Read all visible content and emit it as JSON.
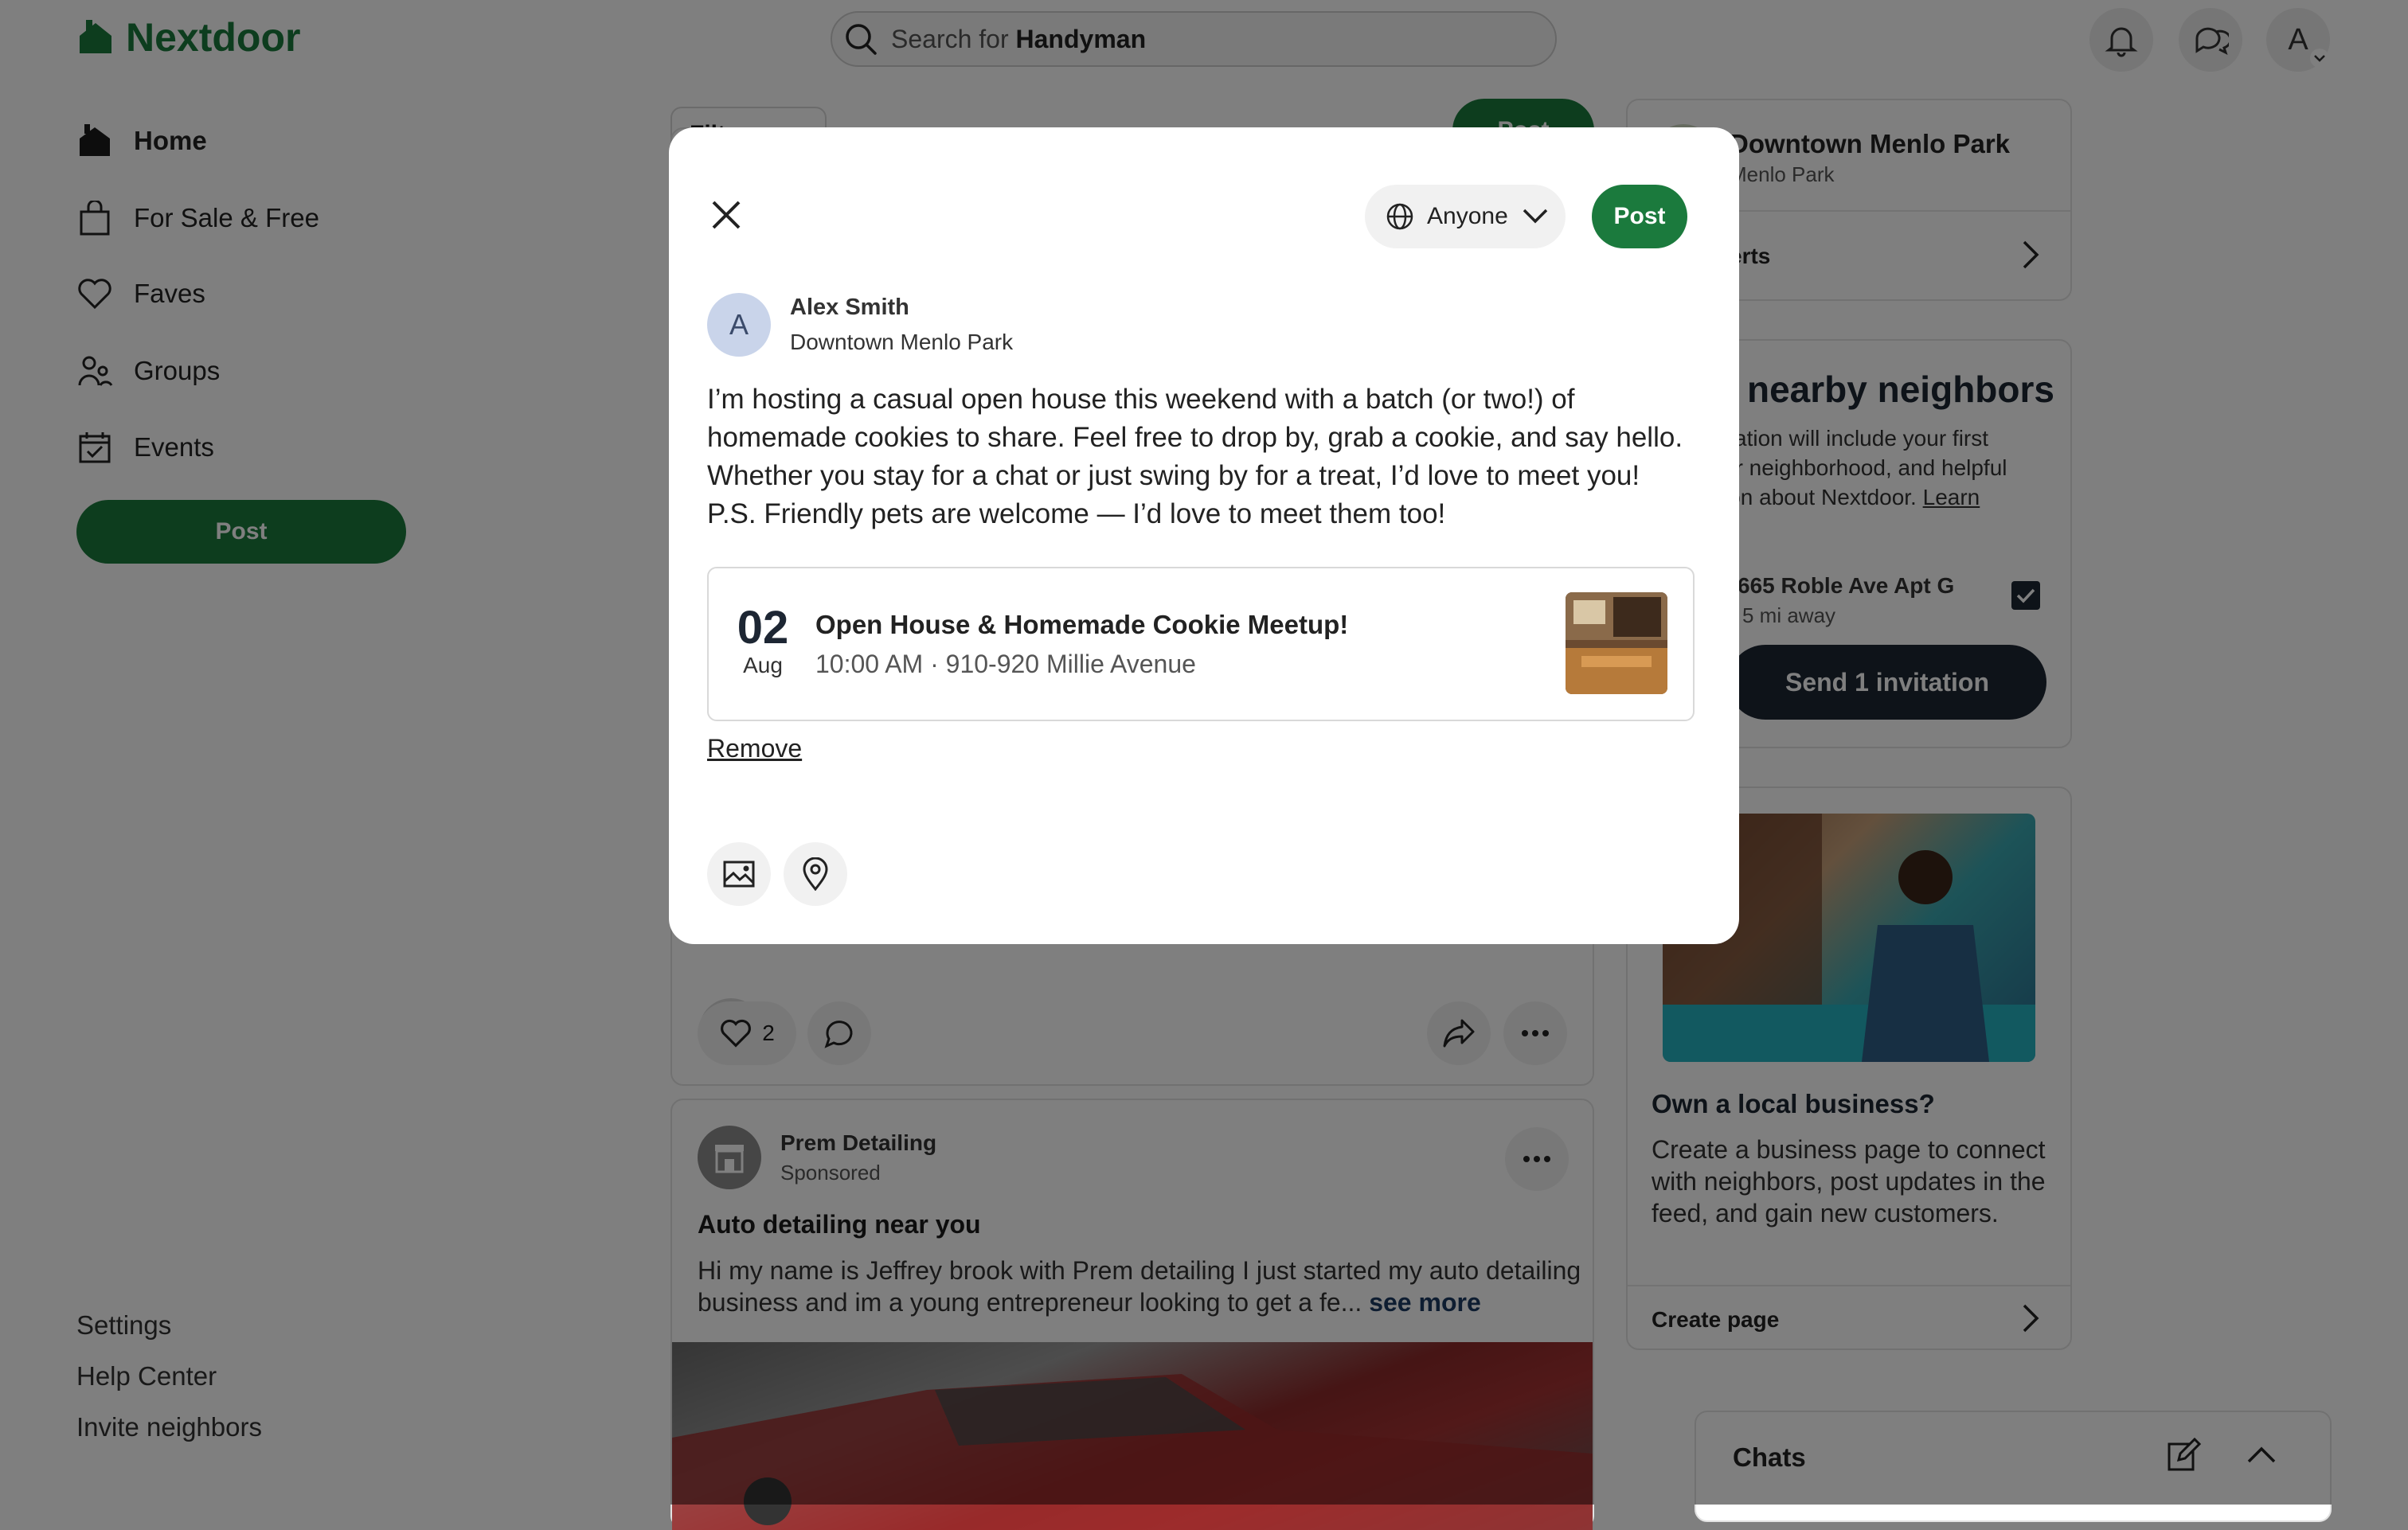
{
  "header": {
    "logo_text": "Nextdoor",
    "search_prefix": "Search for",
    "search_term": "Handyman",
    "avatar_initial": "A"
  },
  "sidebar": {
    "items": [
      {
        "label": "Home",
        "icon": "home-icon",
        "active": true
      },
      {
        "label": "For Sale & Free",
        "icon": "shopping-bag-icon"
      },
      {
        "label": "Faves",
        "icon": "heart-icon"
      },
      {
        "label": "Groups",
        "icon": "groups-icon"
      },
      {
        "label": "Events",
        "icon": "calendar-icon"
      }
    ],
    "post_label": "Post",
    "footer": [
      "Settings",
      "Help Center",
      "Invite neighbors"
    ]
  },
  "feed": {
    "filter_label": "Filt",
    "post_label": "Post",
    "post_actions": {
      "like_count": "2"
    },
    "sponsored": {
      "name": "Prem Detailing",
      "tag": "Sponsored",
      "title": "Auto detailing near you",
      "text": "Hi my name is Jeffrey brook with Prem detailing I just started my auto detailing business and im a young entrepreneur looking to get a fe...",
      "see_more": "see more"
    }
  },
  "right_rail": {
    "neighborhood": {
      "title": "Downtown Menlo Park",
      "subtitle": "Menlo Park",
      "alerts_label": "erts"
    },
    "invite": {
      "title": "nearby neighbors",
      "text_lines": [
        "itation will include your first",
        "ur neighborhood, and helpful",
        "ion about Nextdoor."
      ],
      "learn_label": "Learn",
      "address": "665 Roble Ave Apt G",
      "distance": "5 mi away",
      "send_label": "Send 1 invitation"
    },
    "business": {
      "title": "Own a local business?",
      "text": "Create a business page to connect with neighbors, post updates in the feed, and gain new customers.",
      "cta": "Create page"
    },
    "chats_label": "Chats"
  },
  "modal": {
    "audience_label": "Anyone",
    "post_label": "Post",
    "author": {
      "initial": "A",
      "name": "Alex Smith",
      "neighborhood": "Downtown Menlo Park"
    },
    "body": "I’m hosting a casual open house this weekend with a batch (or two!) of homemade cookies to share. Feel free to drop by, grab a cookie, and say hello. Whether you stay for a chat or just swing by for a treat, I’d love to meet you!\nP.S. Friendly pets are welcome — I’d love to meet them too!",
    "event": {
      "day": "02",
      "month": "Aug",
      "title": "Open House & Homemade Cookie Meetup!",
      "details": "10:00 AM · 910-920 Millie Avenue"
    },
    "remove_label": "Remove"
  },
  "colors": {
    "brand_green": "#1b7a3d",
    "dark_navy": "#1d2633",
    "overlay": "rgba(0,0,0,0.5)"
  }
}
